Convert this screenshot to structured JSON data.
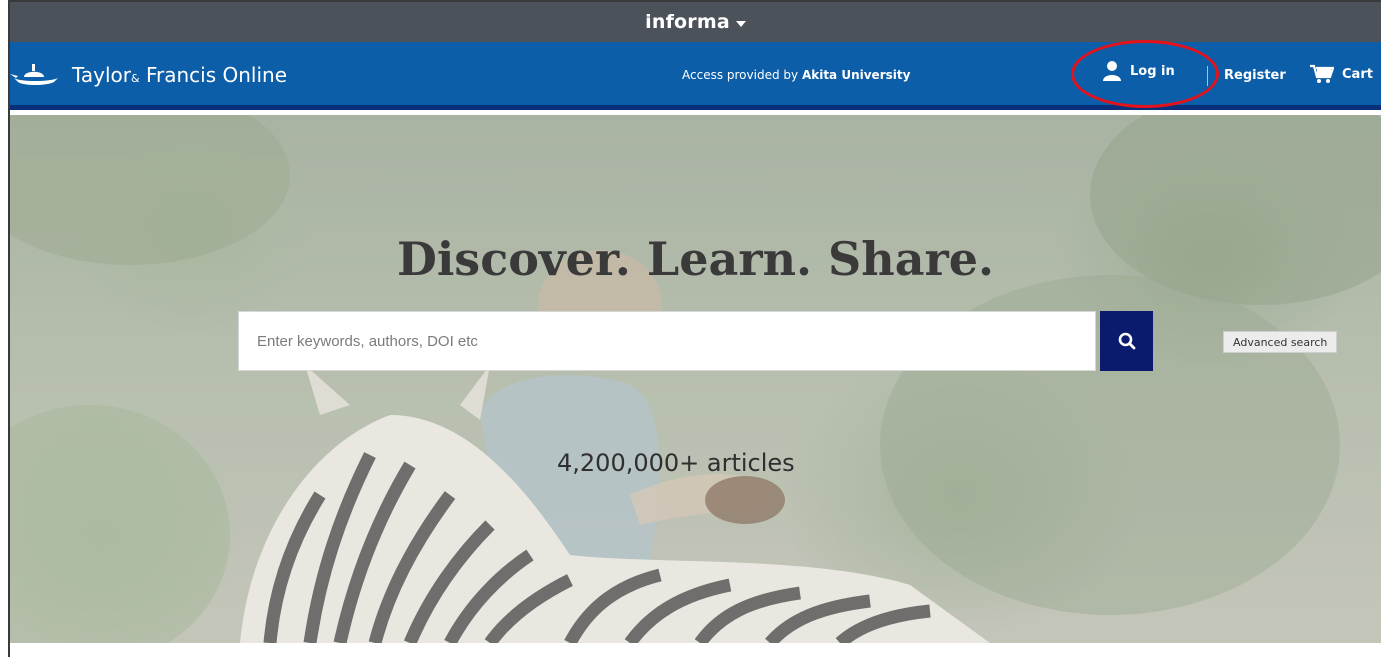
{
  "topbar": {
    "brand": "informa"
  },
  "header": {
    "logo_text": "Taylor",
    "logo_amp": "&",
    "logo_text_2": "Francis Online",
    "access_prefix": "Access provided by ",
    "access_institution": "Akita University",
    "login_label": "Log in",
    "register_label": "Register",
    "cart_label": "Cart"
  },
  "hero": {
    "title": "Discover. Learn. Share.",
    "search_placeholder": "Enter keywords, authors, DOI etc",
    "advanced_search_label": "Advanced search",
    "article_count": "4,200,000+ articles"
  },
  "colors": {
    "topbar_bg": "#4c5259",
    "header_bg": "#0d5ea8",
    "search_button_bg": "#0a1b6e",
    "highlight_circle": "#e3121b"
  },
  "icons": [
    "teapot-logo-icon",
    "user-icon",
    "cart-icon",
    "search-icon",
    "caret-down-icon"
  ]
}
